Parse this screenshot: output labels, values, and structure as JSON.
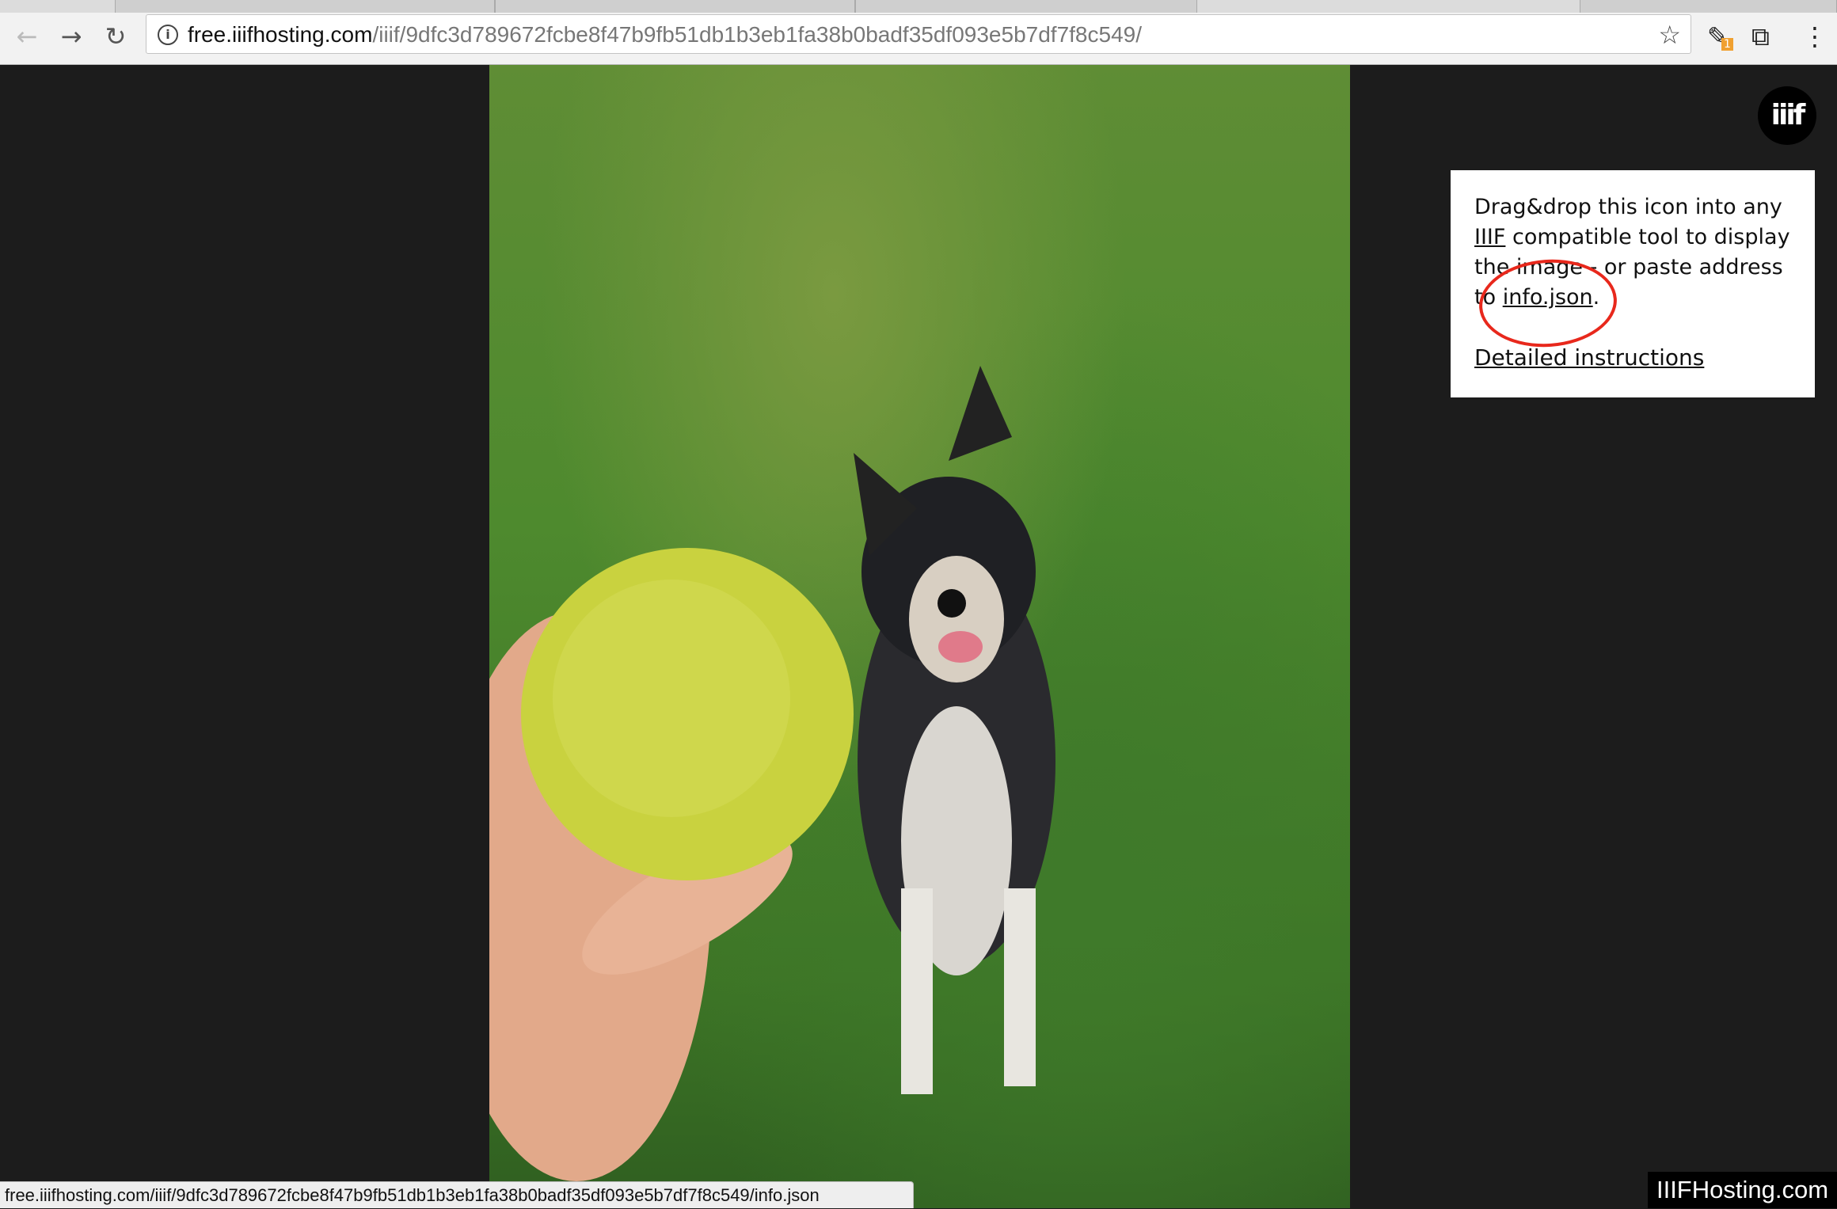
{
  "browser": {
    "url_host": "free.iiifhosting.com",
    "url_path": "/iiif/9dfc3d789672fcbe8f47b9fb51db1b3eb1fa38b0badf35df093e5b7df7f8c549/",
    "icons": {
      "back": "arrow-left-icon",
      "forward": "arrow-right-icon",
      "reload": "reload-icon",
      "info": "info-icon",
      "star": "star-icon",
      "extension": "extension-icon",
      "open_external": "external-link-icon",
      "menu": "kebab-menu-icon"
    },
    "extension_badge": "1",
    "status_url": "free.iiifhosting.com/iiif/9dfc3d789672fcbe8f47b9fb51db1b3eb1fa38b0badf35df093e5b7df7f8c549/info.json"
  },
  "viewer": {
    "logo_text": "iiif",
    "info": {
      "text_1": "Drag&drop this icon into any ",
      "iiif_link": "IIIF",
      "text_2": " compatible tool to display the image - or paste address to ",
      "info_json_link": "info.json",
      "text_3": ".",
      "instructions_link": "Detailed instructions"
    },
    "annotation_color": "#e8281c",
    "brand": "IIIFHosting.com"
  }
}
